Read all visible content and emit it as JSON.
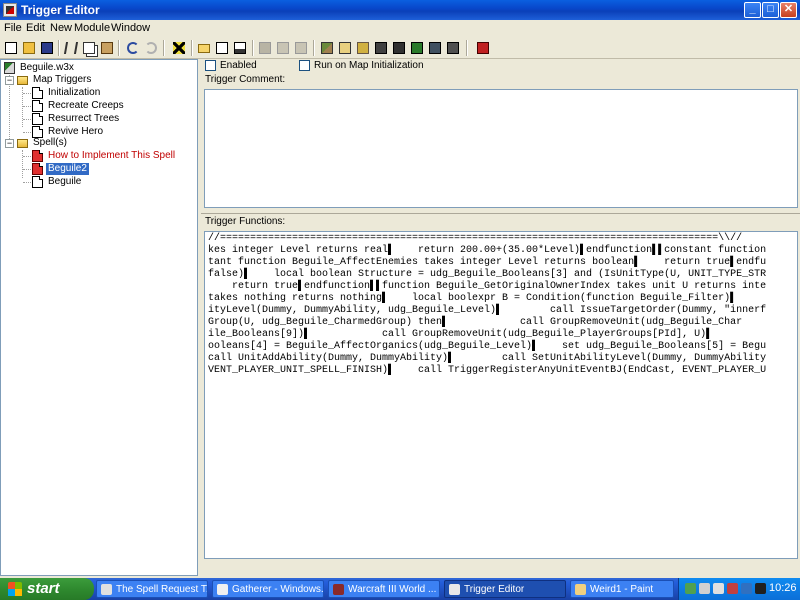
{
  "window": {
    "title": "Trigger Editor"
  },
  "menu": [
    "File",
    "Edit",
    "New",
    "Module",
    "Window"
  ],
  "tree": {
    "root": "Beguile.w3x",
    "map_category": "Map Triggers",
    "map_items": [
      "Initialization",
      "Recreate Creeps",
      "Resurrect Trees",
      "Revive Hero"
    ],
    "spell_category": "Spell(s)",
    "spell_items": [
      "How to Implement This Spell",
      "Beguile2",
      "Beguile"
    ]
  },
  "trigger": {
    "enabled_label": "Enabled",
    "run_on_init_label": "Run on Map Initialization",
    "comment_label": "Trigger Comment:",
    "functions_label": "Trigger Functions:",
    "code": [
      "//===================================================================================\\\\//",
      "kes integer Level returns real▌    return 200.00+(35.00*Level)▌endfunction▌▌constant function",
      "tant function Beguile_AffectEnemies takes integer Level returns boolean▌    return true▌endfu",
      "false)▌    local boolean Structure = udg_Beguile_Booleans[3] and (IsUnitType(U, UNIT_TYPE_STR",
      "    return true▌endfunction▌▌function Beguile_GetOriginalOwnerIndex takes unit U returns inte",
      "takes nothing returns nothing▌    local boolexpr B = Condition(function Beguile_Filter)▌",
      "ityLevel(Dummy, DummyAbility, udg_Beguile_Level)▌        call IssueTargetOrder(Dummy, \"innerf",
      "Group(U, udg_Beguile_CharmedGroup) then▌            call GroupRemoveUnit(udg_Beguile_Char",
      "ile_Booleans[9])▌            call GroupRemoveUnit(udg_Beguile_PlayerGroups[PId], U)▌",
      "ooleans[4] = Beguile_AffectOrganics(udg_Beguile_Level)▌    set udg_Beguile_Booleans[5] = Begu",
      "call UnitAddAbility(Dummy, DummyAbility)▌        call SetUnitAbilityLevel(Dummy, DummyAbility",
      "VENT_PLAYER_UNIT_SPELL_FINISH)▌    call TriggerRegisterAnyUnitEventBJ(EndCast, EVENT_PLAYER_U"
    ]
  },
  "taskbar": {
    "start_label": "start",
    "tasks": [
      "The Spell Request T...",
      "Gatherer - Windows...",
      "Warcraft III World ...",
      "Trigger Editor",
      "Weird1 - Paint"
    ],
    "clock": "10:26"
  },
  "colors": {
    "selection": "#316ac5",
    "error_text": "#c00000",
    "title_bar": "#0a5fe0",
    "taskbar": "#245edb",
    "start_green": "#2f8a2f"
  }
}
